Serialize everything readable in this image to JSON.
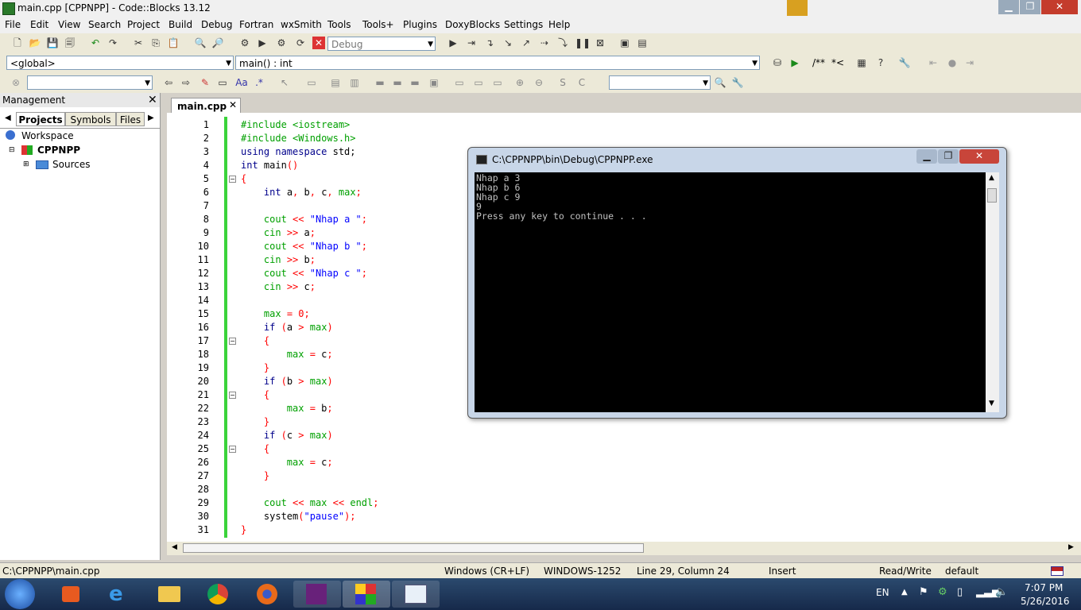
{
  "window": {
    "title": "main.cpp [CPPNPP] - Code::Blocks 13.12"
  },
  "menu": [
    "File",
    "Edit",
    "View",
    "Search",
    "Project",
    "Build",
    "Debug",
    "Fortran",
    "wxSmith",
    "Tools",
    "Tools+",
    "Plugins",
    "DoxyBlocks",
    "Settings",
    "Help"
  ],
  "toolbar": {
    "build_target": "Debug",
    "scope": "<global>",
    "function": "main() : int",
    "comment_a": "/**",
    "comment_b": "*<"
  },
  "management": {
    "title": "Management",
    "tabs": [
      "Projects",
      "Symbols",
      "Files"
    ],
    "tree": {
      "workspace": "Workspace",
      "project": "CPPNPP",
      "folder": "Sources"
    }
  },
  "editor": {
    "tab": "main.cpp",
    "line_numbers": [
      "1",
      "2",
      "3",
      "4",
      "5",
      "6",
      "7",
      "8",
      "9",
      "10",
      "11",
      "12",
      "13",
      "14",
      "15",
      "16",
      "17",
      "18",
      "19",
      "20",
      "21",
      "22",
      "23",
      "24",
      "25",
      "26",
      "27",
      "28",
      "29",
      "30",
      "31"
    ]
  },
  "console": {
    "title": "C:\\CPPNPP\\bin\\Debug\\CPPNPP.exe",
    "lines": [
      "Nhap a 3",
      "Nhap b 6",
      "Nhap c 9",
      "9",
      "Press any key to continue . . ."
    ]
  },
  "status": {
    "file": "C:\\CPPNPP\\main.cpp",
    "eol": "Windows (CR+LF)",
    "encoding": "WINDOWS-1252",
    "position": "Line 29, Column 24",
    "mode": "Insert",
    "access": "Read/Write",
    "profile": "default"
  },
  "taskbar": {
    "lang": "EN",
    "time": "7:07 PM",
    "date": "5/26/2016"
  }
}
